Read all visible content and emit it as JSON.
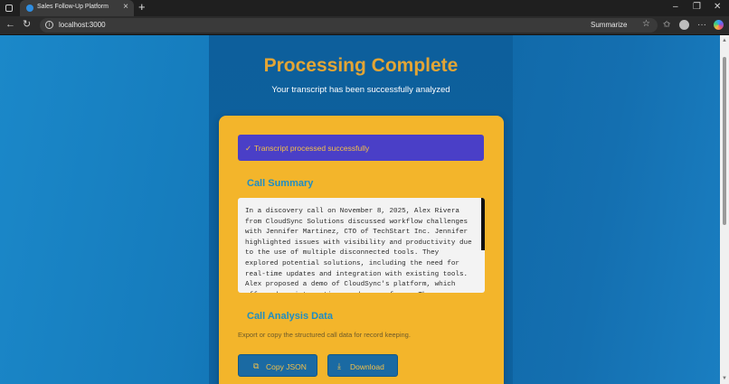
{
  "browser": {
    "tab_title": "Sales Follow-Up Platform",
    "url": "localhost:3000",
    "summarize_label": "Summarize"
  },
  "page": {
    "heading": "Processing Complete",
    "subheading": "Your transcript has been successfully analyzed",
    "success_message": "Transcript processed successfully",
    "call_summary_title": "Call Summary",
    "call_summary_text": "In a discovery call on November 8, 2025, Alex Rivera from CloudSync Solutions discussed workflow challenges with Jennifer Martinez, CTO of TechStart Inc. Jennifer highlighted issues with visibility and productivity due to the use of multiple disconnected tools. They explored potential solutions, including the need for real-time updates and integration with existing tools. Alex proposed a demo of CloudSync's platform, which offers deep integrations and ease of use. They",
    "analysis_title": "Call Analysis Data",
    "analysis_helper": "Export or copy the structured call data for record keeping.",
    "copy_json_label": "Copy JSON",
    "download_label": "Download"
  },
  "colors": {
    "accent_gold": "#f3b52b",
    "heading_gold": "#e3a535",
    "success_bg": "#4a3fc7",
    "button_blue": "#1a6aa3",
    "section_title_blue": "#1f8dc3"
  },
  "icons": {
    "copy": "copy-icon",
    "download": "download-icon",
    "check": "check-icon"
  }
}
